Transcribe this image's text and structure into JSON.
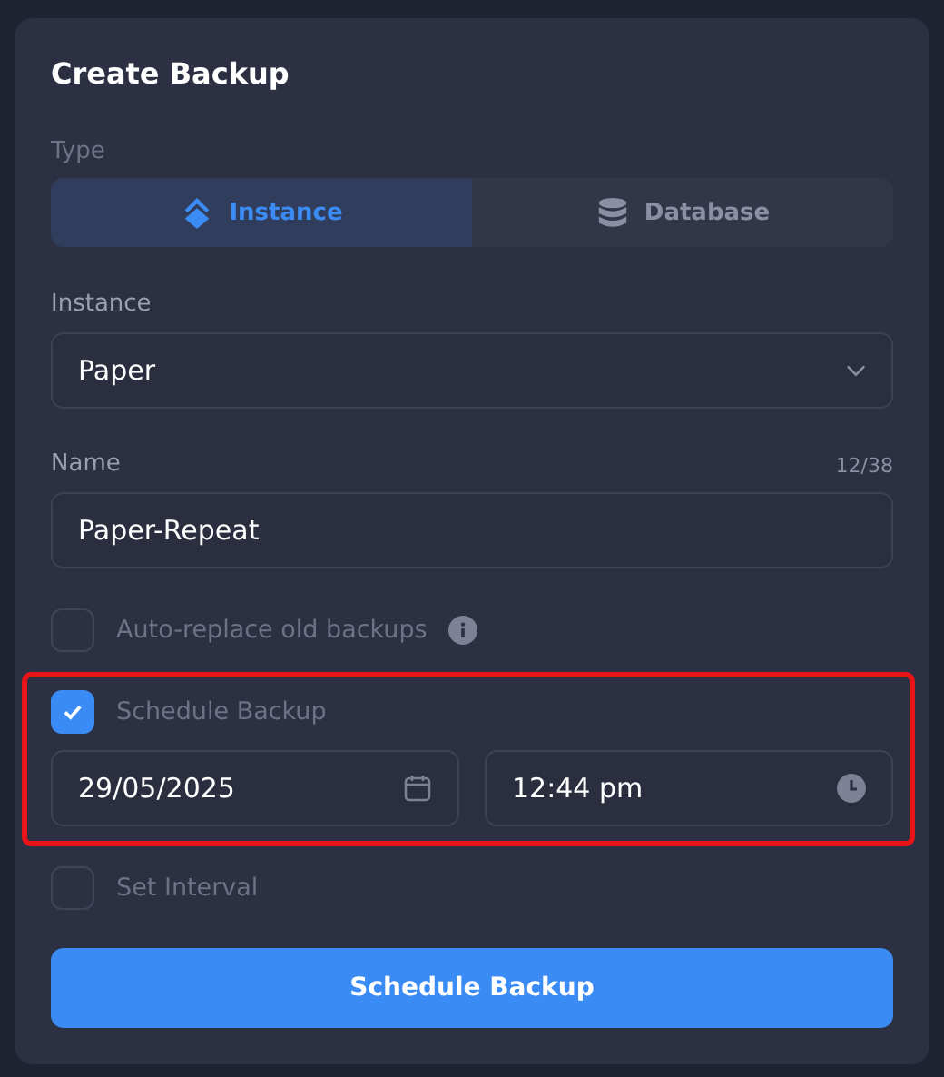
{
  "title": "Create Backup",
  "type": {
    "label": "Type",
    "options": [
      {
        "label": "Instance",
        "kind": "instance",
        "selected": true
      },
      {
        "label": "Database",
        "kind": "database",
        "selected": false
      }
    ]
  },
  "instance": {
    "label": "Instance",
    "value": "Paper"
  },
  "name": {
    "label": "Name",
    "counter": "12/38",
    "value": "Paper-Repeat"
  },
  "auto_replace": {
    "label": "Auto-replace old backups",
    "checked": false
  },
  "schedule": {
    "label": "Schedule Backup",
    "checked": true,
    "highlighted": true,
    "date": "29/05/2025",
    "time": "12:44 pm"
  },
  "interval": {
    "label": "Set Interval",
    "checked": false
  },
  "submit": "Schedule Backup"
}
